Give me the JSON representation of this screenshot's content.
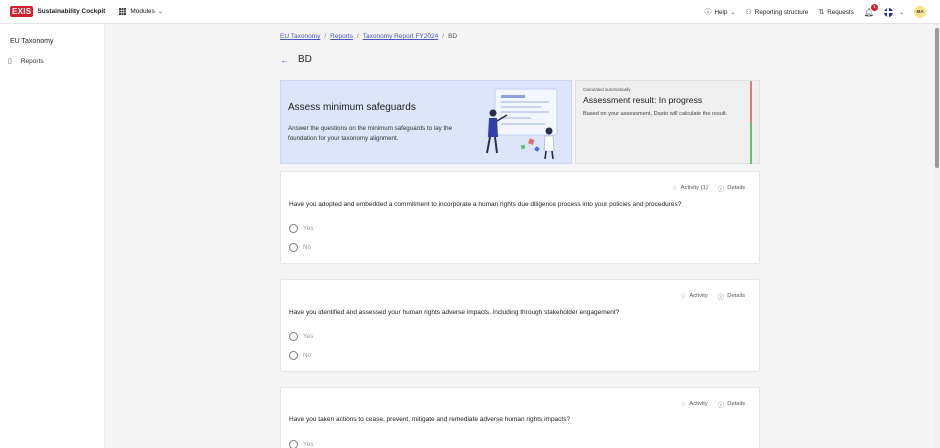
{
  "app": {
    "logo_text": "EXIS",
    "brand": "Sustainability Cockpit",
    "modules_label": "Modules",
    "help_label": "Help",
    "reporting_label": "Reporting structure",
    "requests_label": "Requests",
    "notification_count": "1",
    "avatar_initials": "MA"
  },
  "sidebar": {
    "title": "EU Taxonomy",
    "items": [
      {
        "label": "Reports",
        "icon": "document-icon"
      }
    ]
  },
  "breadcrumb": {
    "items": [
      "EU Taxonomy",
      "Reports",
      "Taxonomy Report FY2024"
    ],
    "current": "BD"
  },
  "page": {
    "title": "BD"
  },
  "banner": {
    "title": "Assess minimum safeguards",
    "text": "Answer the questions on the minimum safeguards to lay the foundation for your taxonomy alignment."
  },
  "result": {
    "small_label": "Calculated automatically",
    "title": "Assessment result: In progress",
    "text": "Based on your assessment, Dasto will calculate the result."
  },
  "questions": [
    {
      "activity_label": "Activity (1)",
      "details_label": "Details",
      "text": "Have you adopted and embedded a commitment to incorporate a human rights due diligence process into your policies and procedures?",
      "options": [
        "Yes",
        "No"
      ]
    },
    {
      "activity_label": "Activity",
      "details_label": "Details",
      "text": "Have you identified and assessed your human rights adverse impacts, including through stakeholder engagement?",
      "options": [
        "Yes",
        "No"
      ]
    },
    {
      "activity_label": "Activity",
      "details_label": "Details",
      "text": "Have you taken actions to cease, prevent, mitigate and remediate adverse human rights impacts?",
      "options": [
        "Yes"
      ]
    }
  ],
  "colors": {
    "accent": "#4a57c2",
    "brand_red": "#d2202f",
    "banner_bg": "#dde5fb",
    "status_red": "#e07b7b",
    "status_green": "#5cc86c"
  }
}
